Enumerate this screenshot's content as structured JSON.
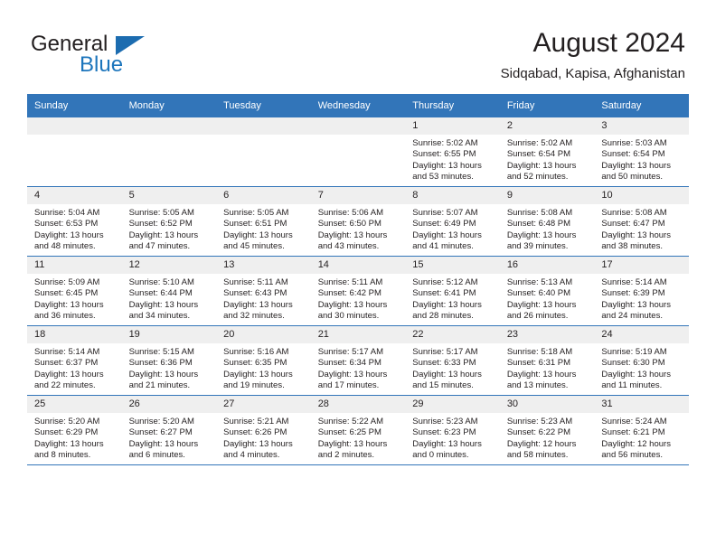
{
  "brand": {
    "word1": "General",
    "word2": "Blue",
    "accent_color": "#1c75bc"
  },
  "header": {
    "title": "August 2024",
    "location": "Sidqabad, Kapisa, Afghanistan"
  },
  "calendar": {
    "header_bg": "#3275b9",
    "daynum_bg": "#efefef",
    "weekday_headers": [
      "Sunday",
      "Monday",
      "Tuesday",
      "Wednesday",
      "Thursday",
      "Friday",
      "Saturday"
    ],
    "weeks": [
      [
        {
          "day": "",
          "sunrise": "",
          "sunset": "",
          "daylight1": "",
          "daylight2": ""
        },
        {
          "day": "",
          "sunrise": "",
          "sunset": "",
          "daylight1": "",
          "daylight2": ""
        },
        {
          "day": "",
          "sunrise": "",
          "sunset": "",
          "daylight1": "",
          "daylight2": ""
        },
        {
          "day": "",
          "sunrise": "",
          "sunset": "",
          "daylight1": "",
          "daylight2": ""
        },
        {
          "day": "1",
          "sunrise": "Sunrise: 5:02 AM",
          "sunset": "Sunset: 6:55 PM",
          "daylight1": "Daylight: 13 hours",
          "daylight2": "and 53 minutes."
        },
        {
          "day": "2",
          "sunrise": "Sunrise: 5:02 AM",
          "sunset": "Sunset: 6:54 PM",
          "daylight1": "Daylight: 13 hours",
          "daylight2": "and 52 minutes."
        },
        {
          "day": "3",
          "sunrise": "Sunrise: 5:03 AM",
          "sunset": "Sunset: 6:54 PM",
          "daylight1": "Daylight: 13 hours",
          "daylight2": "and 50 minutes."
        }
      ],
      [
        {
          "day": "4",
          "sunrise": "Sunrise: 5:04 AM",
          "sunset": "Sunset: 6:53 PM",
          "daylight1": "Daylight: 13 hours",
          "daylight2": "and 48 minutes."
        },
        {
          "day": "5",
          "sunrise": "Sunrise: 5:05 AM",
          "sunset": "Sunset: 6:52 PM",
          "daylight1": "Daylight: 13 hours",
          "daylight2": "and 47 minutes."
        },
        {
          "day": "6",
          "sunrise": "Sunrise: 5:05 AM",
          "sunset": "Sunset: 6:51 PM",
          "daylight1": "Daylight: 13 hours",
          "daylight2": "and 45 minutes."
        },
        {
          "day": "7",
          "sunrise": "Sunrise: 5:06 AM",
          "sunset": "Sunset: 6:50 PM",
          "daylight1": "Daylight: 13 hours",
          "daylight2": "and 43 minutes."
        },
        {
          "day": "8",
          "sunrise": "Sunrise: 5:07 AM",
          "sunset": "Sunset: 6:49 PM",
          "daylight1": "Daylight: 13 hours",
          "daylight2": "and 41 minutes."
        },
        {
          "day": "9",
          "sunrise": "Sunrise: 5:08 AM",
          "sunset": "Sunset: 6:48 PM",
          "daylight1": "Daylight: 13 hours",
          "daylight2": "and 39 minutes."
        },
        {
          "day": "10",
          "sunrise": "Sunrise: 5:08 AM",
          "sunset": "Sunset: 6:47 PM",
          "daylight1": "Daylight: 13 hours",
          "daylight2": "and 38 minutes."
        }
      ],
      [
        {
          "day": "11",
          "sunrise": "Sunrise: 5:09 AM",
          "sunset": "Sunset: 6:45 PM",
          "daylight1": "Daylight: 13 hours",
          "daylight2": "and 36 minutes."
        },
        {
          "day": "12",
          "sunrise": "Sunrise: 5:10 AM",
          "sunset": "Sunset: 6:44 PM",
          "daylight1": "Daylight: 13 hours",
          "daylight2": "and 34 minutes."
        },
        {
          "day": "13",
          "sunrise": "Sunrise: 5:11 AM",
          "sunset": "Sunset: 6:43 PM",
          "daylight1": "Daylight: 13 hours",
          "daylight2": "and 32 minutes."
        },
        {
          "day": "14",
          "sunrise": "Sunrise: 5:11 AM",
          "sunset": "Sunset: 6:42 PM",
          "daylight1": "Daylight: 13 hours",
          "daylight2": "and 30 minutes."
        },
        {
          "day": "15",
          "sunrise": "Sunrise: 5:12 AM",
          "sunset": "Sunset: 6:41 PM",
          "daylight1": "Daylight: 13 hours",
          "daylight2": "and 28 minutes."
        },
        {
          "day": "16",
          "sunrise": "Sunrise: 5:13 AM",
          "sunset": "Sunset: 6:40 PM",
          "daylight1": "Daylight: 13 hours",
          "daylight2": "and 26 minutes."
        },
        {
          "day": "17",
          "sunrise": "Sunrise: 5:14 AM",
          "sunset": "Sunset: 6:39 PM",
          "daylight1": "Daylight: 13 hours",
          "daylight2": "and 24 minutes."
        }
      ],
      [
        {
          "day": "18",
          "sunrise": "Sunrise: 5:14 AM",
          "sunset": "Sunset: 6:37 PM",
          "daylight1": "Daylight: 13 hours",
          "daylight2": "and 22 minutes."
        },
        {
          "day": "19",
          "sunrise": "Sunrise: 5:15 AM",
          "sunset": "Sunset: 6:36 PM",
          "daylight1": "Daylight: 13 hours",
          "daylight2": "and 21 minutes."
        },
        {
          "day": "20",
          "sunrise": "Sunrise: 5:16 AM",
          "sunset": "Sunset: 6:35 PM",
          "daylight1": "Daylight: 13 hours",
          "daylight2": "and 19 minutes."
        },
        {
          "day": "21",
          "sunrise": "Sunrise: 5:17 AM",
          "sunset": "Sunset: 6:34 PM",
          "daylight1": "Daylight: 13 hours",
          "daylight2": "and 17 minutes."
        },
        {
          "day": "22",
          "sunrise": "Sunrise: 5:17 AM",
          "sunset": "Sunset: 6:33 PM",
          "daylight1": "Daylight: 13 hours",
          "daylight2": "and 15 minutes."
        },
        {
          "day": "23",
          "sunrise": "Sunrise: 5:18 AM",
          "sunset": "Sunset: 6:31 PM",
          "daylight1": "Daylight: 13 hours",
          "daylight2": "and 13 minutes."
        },
        {
          "day": "24",
          "sunrise": "Sunrise: 5:19 AM",
          "sunset": "Sunset: 6:30 PM",
          "daylight1": "Daylight: 13 hours",
          "daylight2": "and 11 minutes."
        }
      ],
      [
        {
          "day": "25",
          "sunrise": "Sunrise: 5:20 AM",
          "sunset": "Sunset: 6:29 PM",
          "daylight1": "Daylight: 13 hours",
          "daylight2": "and 8 minutes."
        },
        {
          "day": "26",
          "sunrise": "Sunrise: 5:20 AM",
          "sunset": "Sunset: 6:27 PM",
          "daylight1": "Daylight: 13 hours",
          "daylight2": "and 6 minutes."
        },
        {
          "day": "27",
          "sunrise": "Sunrise: 5:21 AM",
          "sunset": "Sunset: 6:26 PM",
          "daylight1": "Daylight: 13 hours",
          "daylight2": "and 4 minutes."
        },
        {
          "day": "28",
          "sunrise": "Sunrise: 5:22 AM",
          "sunset": "Sunset: 6:25 PM",
          "daylight1": "Daylight: 13 hours",
          "daylight2": "and 2 minutes."
        },
        {
          "day": "29",
          "sunrise": "Sunrise: 5:23 AM",
          "sunset": "Sunset: 6:23 PM",
          "daylight1": "Daylight: 13 hours",
          "daylight2": "and 0 minutes."
        },
        {
          "day": "30",
          "sunrise": "Sunrise: 5:23 AM",
          "sunset": "Sunset: 6:22 PM",
          "daylight1": "Daylight: 12 hours",
          "daylight2": "and 58 minutes."
        },
        {
          "day": "31",
          "sunrise": "Sunrise: 5:24 AM",
          "sunset": "Sunset: 6:21 PM",
          "daylight1": "Daylight: 12 hours",
          "daylight2": "and 56 minutes."
        }
      ]
    ]
  }
}
